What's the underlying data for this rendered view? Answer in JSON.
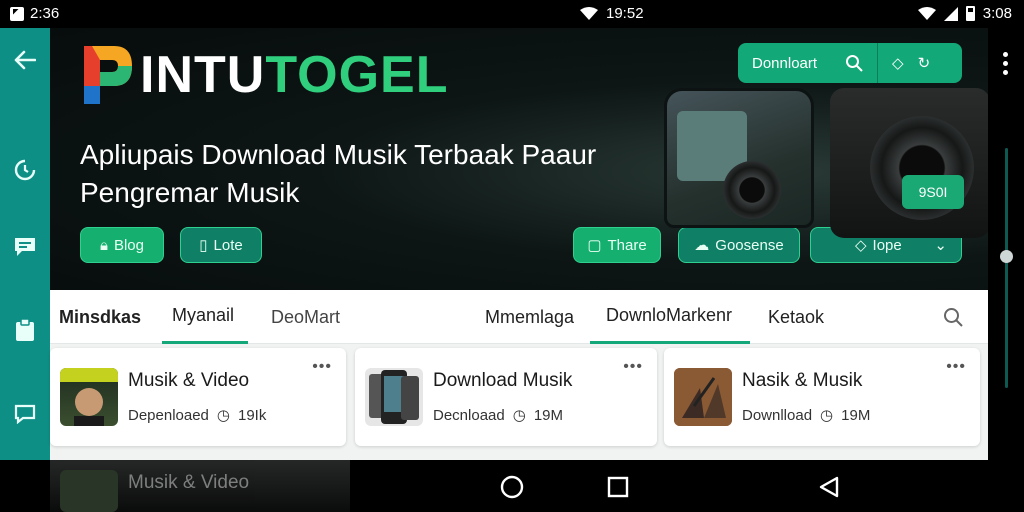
{
  "status_bar": {
    "time_left": "2:36",
    "time_center": "19:52",
    "time_right": "3:08"
  },
  "rail": {
    "items": [
      "back-icon",
      "sync-icon",
      "chat-icon",
      "clipboard-icon",
      "message-icon"
    ]
  },
  "hero": {
    "logo_part1": "INTU",
    "logo_part2": "TOGEL",
    "headline": "Apliupais Download Musik Terbaak Paaur Pengremar Musik",
    "btn_blog": "Blog",
    "btn_lote": "Lote",
    "btn_thare": "Thare",
    "btn_goosense": "Goosense",
    "btn_iope": "Iope",
    "top_download": "Donnloart",
    "badge": "9S0I"
  },
  "tabs": [
    {
      "label": "Minsdkas"
    },
    {
      "label": "Myanail"
    },
    {
      "label": "DeoMart"
    },
    {
      "label": "Mmemlaga"
    },
    {
      "label": "DownloMarkenr"
    },
    {
      "label": "Ketaok"
    }
  ],
  "cards": [
    {
      "title": "Musik & Video",
      "meta_label": "Depenloaed",
      "count": "19Ik"
    },
    {
      "title": "Download Musik",
      "meta_label": "Decnloaad",
      "count": "19M"
    },
    {
      "title": "Nasik & Musik",
      "meta_label": "Downlload",
      "count": "19M"
    }
  ],
  "ghost_row": {
    "title": "Musik & Video"
  },
  "colors": {
    "accent": "#14a77a",
    "rail": "#0e8f86",
    "pill": "#15b070"
  }
}
